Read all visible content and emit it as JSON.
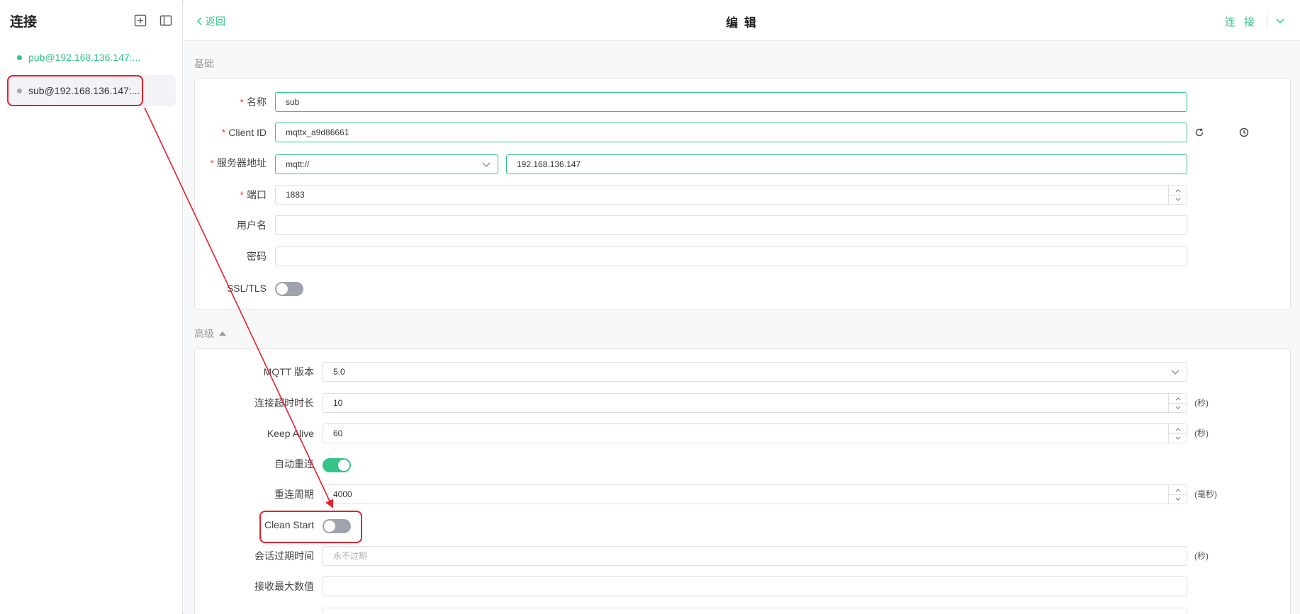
{
  "sidebar": {
    "title": "连接",
    "connections": [
      {
        "label": "pub@192.168.136.147:...",
        "status": "connected"
      },
      {
        "label": "sub@192.168.136.147:...",
        "status": "disconnected"
      }
    ]
  },
  "topbar": {
    "back_label": "返回",
    "title": "编 辑",
    "connect_label": "连 接"
  },
  "basic": {
    "section_title": "基础",
    "name_label": "名称",
    "name_value": "sub",
    "client_id_label": "Client ID",
    "client_id_value": "mqttx_a9d86661",
    "server_label": "服务器地址",
    "protocol_value": "mqtt://",
    "host_value": "192.168.136.147",
    "port_label": "端口",
    "port_value": "1883",
    "username_label": "用户名",
    "username_value": "",
    "password_label": "密码",
    "password_value": "",
    "ssl_label": "SSL/TLS",
    "ssl_enabled": false
  },
  "advanced": {
    "section_title": "高级",
    "mqtt_version_label": "MQTT 版本",
    "mqtt_version_value": "5.0",
    "connect_timeout_label": "连接超时时长",
    "connect_timeout_value": "10",
    "connect_timeout_unit": "(秒)",
    "keep_alive_label": "Keep Alive",
    "keep_alive_value": "60",
    "keep_alive_unit": "(秒)",
    "auto_reconnect_label": "自动重连",
    "auto_reconnect_enabled": true,
    "reconnect_period_label": "重连周期",
    "reconnect_period_value": "4000",
    "reconnect_period_unit": "(毫秒)",
    "clean_start_label": "Clean Start",
    "clean_start_enabled": false,
    "session_expiry_label": "会话过期时间",
    "session_expiry_placeholder": "永不过期",
    "session_expiry_unit": "(秒)",
    "receive_max_label": "接收最大数值",
    "receive_max_value": ""
  },
  "colors": {
    "accent": "#34c388",
    "annotation": "#e8202a",
    "toggle_off": "#9ea3ad"
  }
}
